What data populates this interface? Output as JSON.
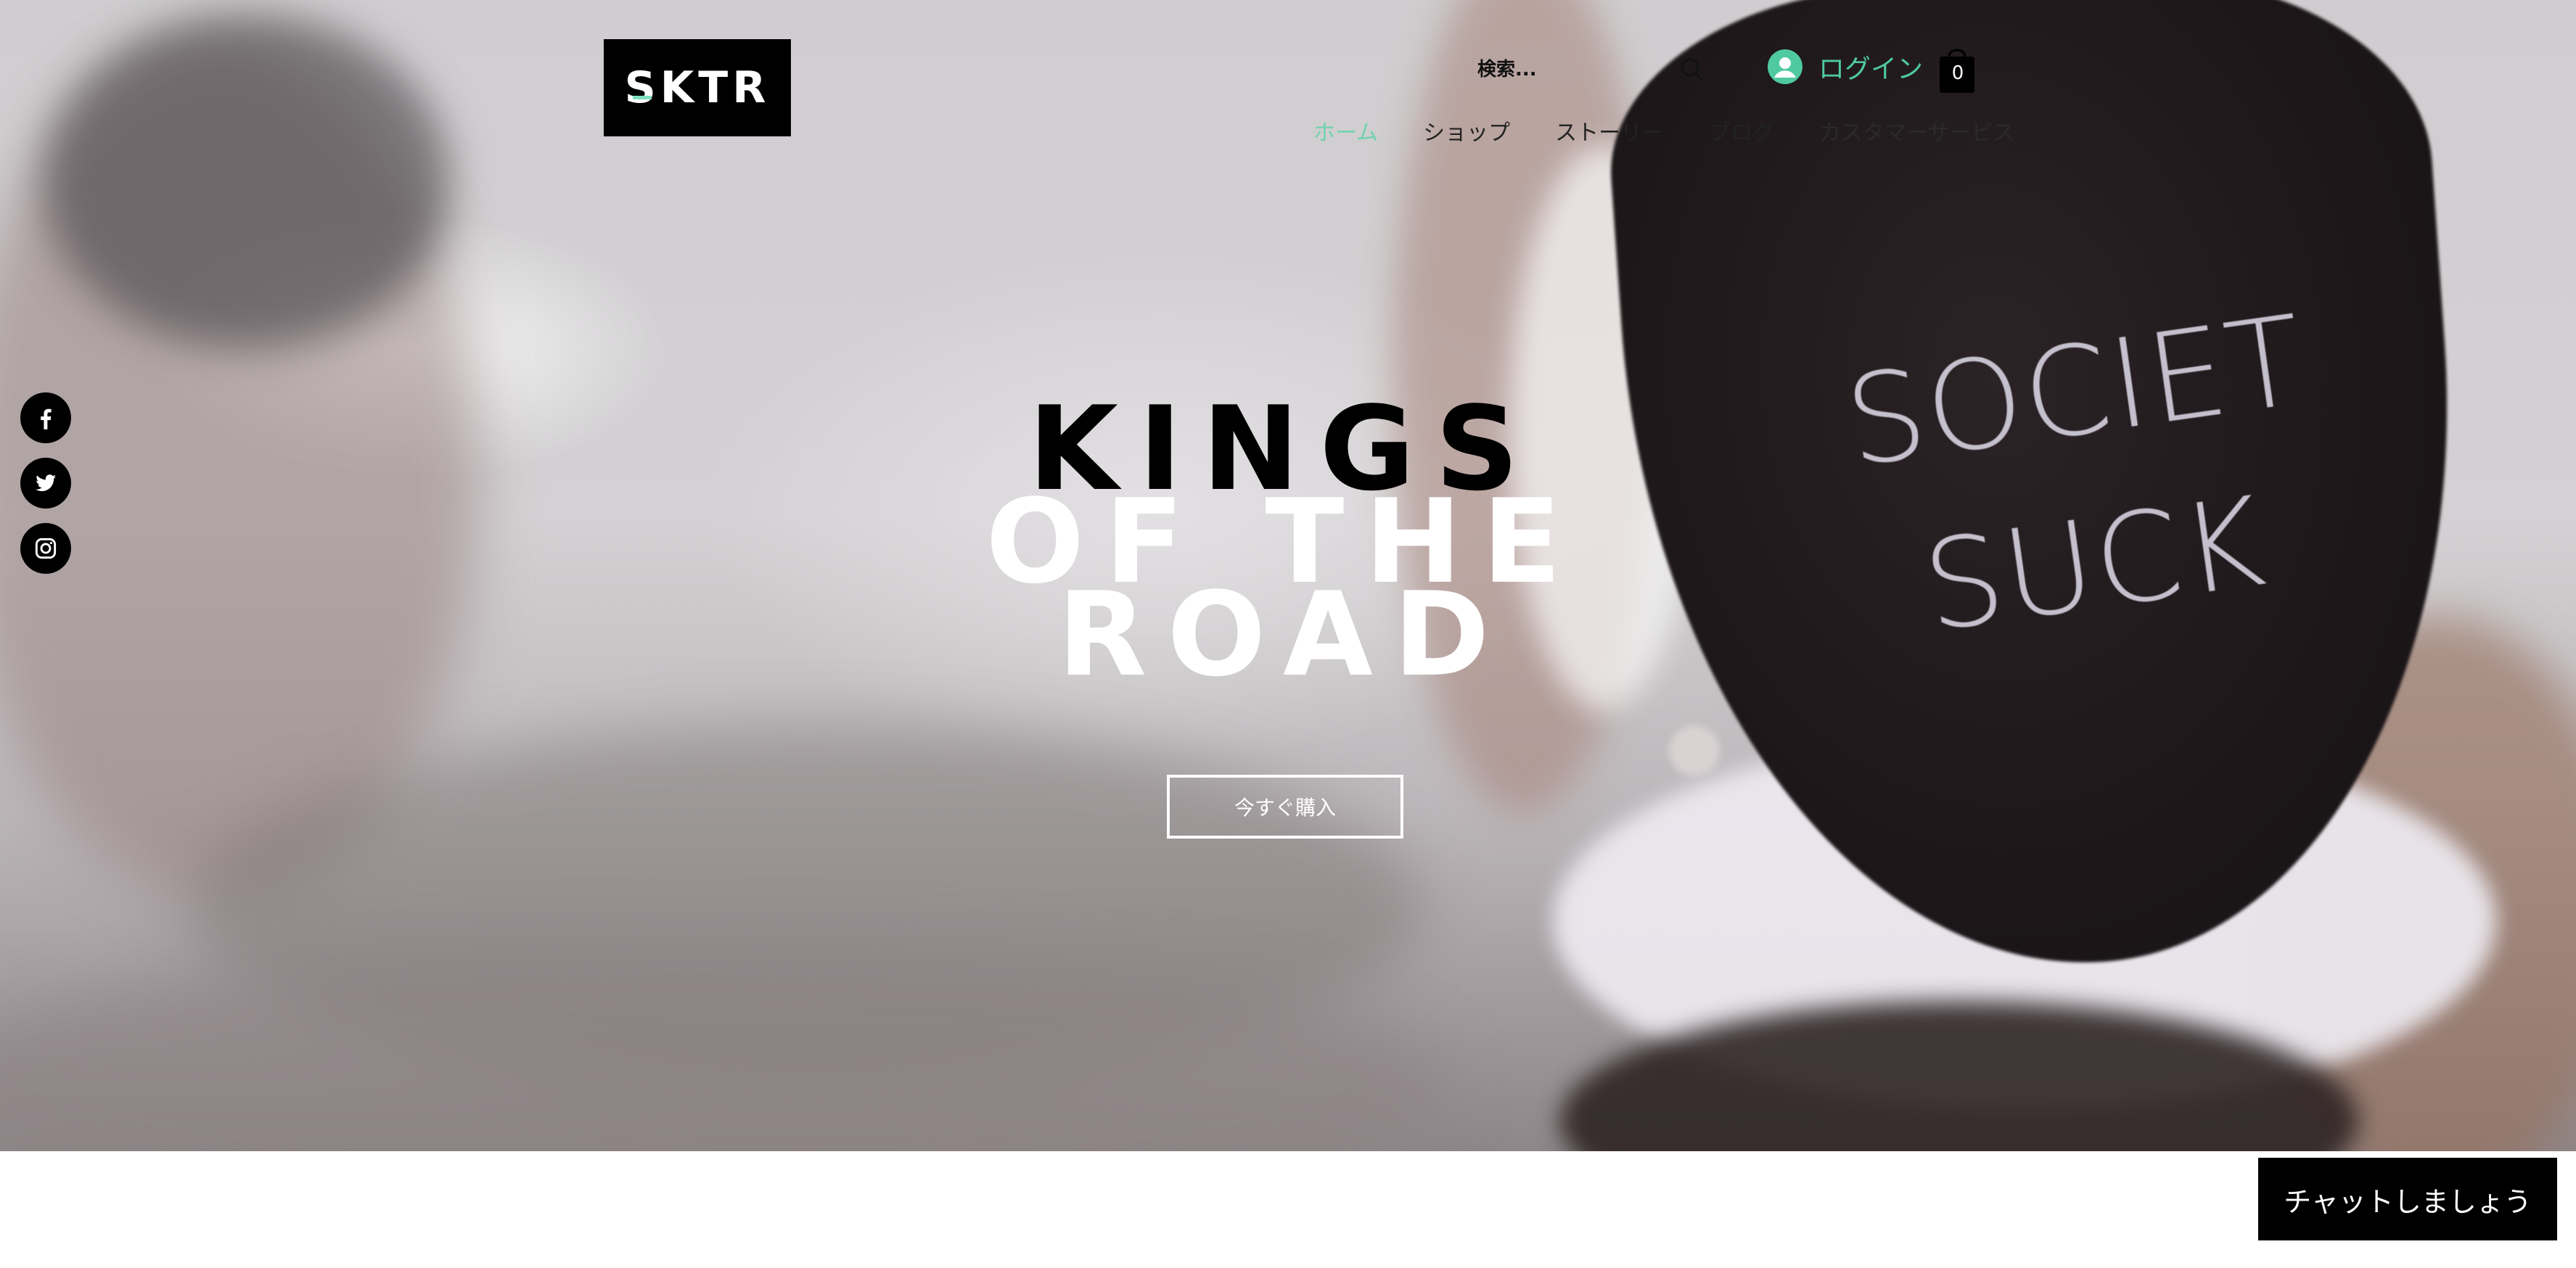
{
  "header": {
    "logo_text": "SKTR",
    "search_placeholder": "検索...",
    "login_label": "ログイン",
    "cart_count": "0"
  },
  "nav": {
    "items": [
      {
        "label": "ホーム",
        "active": true
      },
      {
        "label": "ショップ"
      },
      {
        "label": "ストーリー"
      },
      {
        "label": "ブログ"
      },
      {
        "label": "カスタマーサービス"
      }
    ]
  },
  "social": {
    "icons": [
      "facebook-icon",
      "twitter-icon",
      "instagram-icon"
    ]
  },
  "hero": {
    "headline_line1": "KINGS",
    "headline_line2": "OF THE",
    "headline_line3": "ROAD",
    "cta_label": "今すぐ購入",
    "bag_text_line1": "SOCIET",
    "bag_text_line2": "SUCK"
  },
  "chat": {
    "label": "チャットしましょう"
  },
  "colors": {
    "accent": "#6fd3ad",
    "login_accent": "#4fcaa0",
    "logo_bg": "#000000"
  }
}
